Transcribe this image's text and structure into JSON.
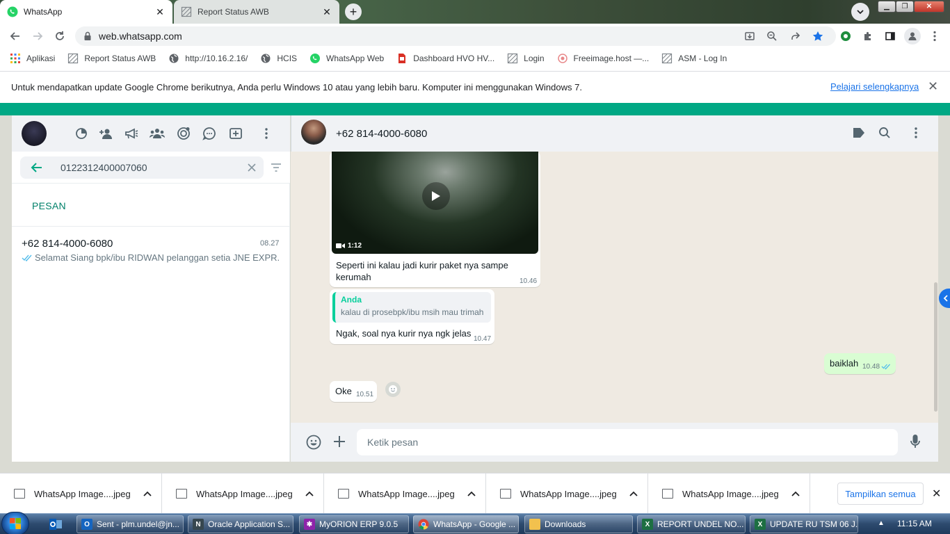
{
  "browser": {
    "tabs": [
      {
        "title": "WhatsApp",
        "active": true
      },
      {
        "title": "Report Status AWB",
        "active": false
      }
    ],
    "url": "web.whatsapp.com",
    "bookmarks": [
      {
        "label": "Aplikasi",
        "icon": "apps-grid-icon"
      },
      {
        "label": "Report Status AWB",
        "icon": "page-icon"
      },
      {
        "label": "http://10.16.2.16/",
        "icon": "globe-icon"
      },
      {
        "label": "HCIS",
        "icon": "globe-icon"
      },
      {
        "label": "WhatsApp Web",
        "icon": "whatsapp-icon"
      },
      {
        "label": "Dashboard HVO HV...",
        "icon": "page-icon"
      },
      {
        "label": "Login",
        "icon": "page-icon"
      },
      {
        "label": "Freeimage.host —...",
        "icon": "page-icon"
      },
      {
        "label": "ASM - Log In",
        "icon": "page-icon"
      }
    ],
    "infobar": {
      "message": "Untuk mendapatkan update Google Chrome berikutnya, Anda perlu Windows 10 atau yang lebih baru. Komputer ini menggunakan Windows 7.",
      "link": "Pelajari selengkapnya"
    }
  },
  "sidebar": {
    "search_value": "0122312400007060",
    "section_label": "PESAN",
    "results": [
      {
        "name": "+62 814-4000-6080",
        "time": "08.27",
        "preview": "Selamat Siang   bpk/ibu RIDWAN pelanggan setia JNE EXPR..."
      }
    ]
  },
  "chat": {
    "contact_name": "+62 814-4000-6080",
    "messages": [
      {
        "type": "video",
        "direction": "in",
        "duration": "1:12",
        "caption": "Seperti ini kalau jadi kurir paket nya sampe kerumah",
        "time": "10.46"
      },
      {
        "type": "reply",
        "direction": "in",
        "quote_author": "Anda",
        "quote_text": "kalau di prosebpk/ibu msih mau trimah",
        "text": "Ngak,  soal nya kurir nya ngk jelas",
        "time": "10.47"
      },
      {
        "type": "text",
        "direction": "out",
        "text": "baiklah",
        "time": "10.48",
        "status": "read"
      },
      {
        "type": "text",
        "direction": "in",
        "text": "Oke",
        "time": "10.51"
      }
    ],
    "composer_placeholder": "Ketik pesan"
  },
  "downloads": {
    "items": [
      "WhatsApp Image....jpeg",
      "WhatsApp Image....jpeg",
      "WhatsApp Image....jpeg",
      "WhatsApp Image....jpeg",
      "WhatsApp Image....jpeg"
    ],
    "show_all": "Tampilkan semua"
  },
  "taskbar": {
    "items": [
      {
        "label": "Sent - plm.undel@jn...",
        "icon": "outlook-icon",
        "color": "#1565c0"
      },
      {
        "label": "Oracle Application S...",
        "icon": "oracle-icon",
        "color": "#37474f"
      },
      {
        "label": "MyORION ERP 9.0.5",
        "icon": "orion-icon",
        "color": "#8e24aa"
      },
      {
        "label": "WhatsApp - Google ...",
        "icon": "chrome-icon",
        "color": "#4285f4"
      },
      {
        "label": "Downloads",
        "icon": "folder-icon",
        "color": "#f2c14e"
      },
      {
        "label": "REPORT UNDEL NO...",
        "icon": "excel-icon",
        "color": "#1d6f42"
      },
      {
        "label": "UPDATE RU TSM 06 J...",
        "icon": "excel-icon",
        "color": "#1d6f42"
      }
    ],
    "clock": "11:15 AM"
  },
  "colors": {
    "accent_green": "#00a884",
    "teal": "#008069",
    "outgoing_bubble": "#d9fdd3",
    "link_blue": "#1a73e8"
  }
}
